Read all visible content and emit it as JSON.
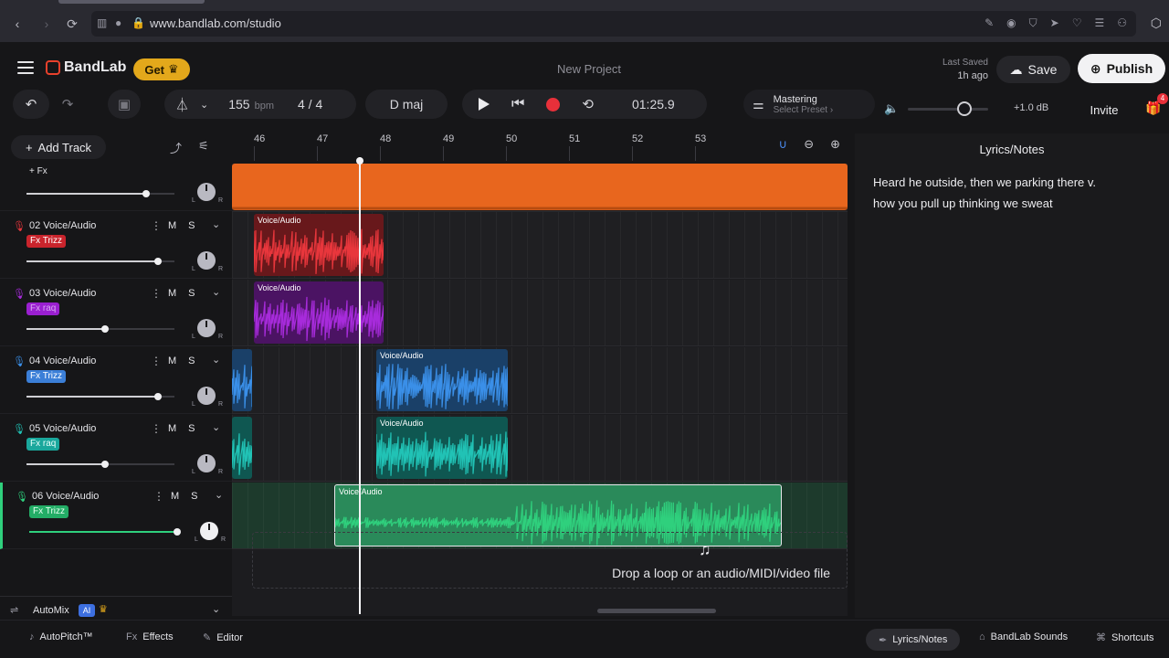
{
  "browser": {
    "url": "www.bandlab.com/studio"
  },
  "header": {
    "brand": "BandLab",
    "get_label": "Get",
    "project_title": "New Project",
    "last_saved_label": "Last Saved",
    "last_saved_value": "1h ago",
    "save_label": "Save",
    "publish_label": "Publish"
  },
  "transport": {
    "bpm": "155",
    "bpm_unit": "bpm",
    "time_signature": "4 / 4",
    "key": "D maj",
    "time": "01:25.9",
    "mastering_title": "Mastering",
    "mastering_preset": "Select Preset",
    "volume_db": "+1.0 dB",
    "volume_level": 0.7,
    "invite_label": "Invite",
    "gift_count": "4"
  },
  "panel": {
    "add_track_label": "Add Track",
    "master_fx": "+ Fx",
    "tracks": [
      {
        "name": "02 Voice/Audio",
        "fx": "Fx Trizz",
        "color": "#e8363c",
        "fx_bg": "#c9242c",
        "fx_fg": "#ffffff",
        "vol": 0.89
      },
      {
        "name": "03 Voice/Audio",
        "fx": "Fx raq",
        "color": "#a72bdb",
        "fx_bg": "#9a1fd0",
        "fx_fg": "#d9a9f3",
        "vol": 0.53
      },
      {
        "name": "04 Voice/Audio",
        "fx": "Fx Trizz",
        "color": "#3a8fe8",
        "fx_bg": "#3b7fd8",
        "fx_fg": "#ffffff",
        "vol": 0.89
      },
      {
        "name": "05 Voice/Audio",
        "fx": "Fx raq",
        "color": "#21c2b5",
        "fx_bg": "#1aa79c",
        "fx_fg": "#e6fffb",
        "vol": 0.53
      },
      {
        "name": "06 Voice/Audio",
        "fx": "Fx Trizz",
        "color": "#2fd07d",
        "fx_bg": "#23ad66",
        "fx_fg": "#e6fff0",
        "vol": 1.0
      }
    ],
    "mute_label": "M",
    "solo_label": "S",
    "pan_left": "L",
    "pan_right": "R",
    "automix_label": "AutoMix",
    "automix_badge": "AI"
  },
  "timeline": {
    "bars": [
      "46",
      "47",
      "48",
      "49",
      "50",
      "51",
      "52",
      "53"
    ],
    "clip_label": "Voice/Audio",
    "drop_text": "Drop a loop or an audio/MIDI/video file"
  },
  "lyrics": {
    "title": "Lyrics/Notes",
    "line1": "Heard he outside, then we parking there v.",
    "line2": "how you pull up thinking we sweat"
  },
  "footer": {
    "autopitch": "AutoPitch™",
    "effects": "Effects",
    "editor": "Editor",
    "lyrics_notes": "Lyrics/Notes",
    "sounds": "BandLab Sounds",
    "shortcuts": "Shortcuts"
  }
}
